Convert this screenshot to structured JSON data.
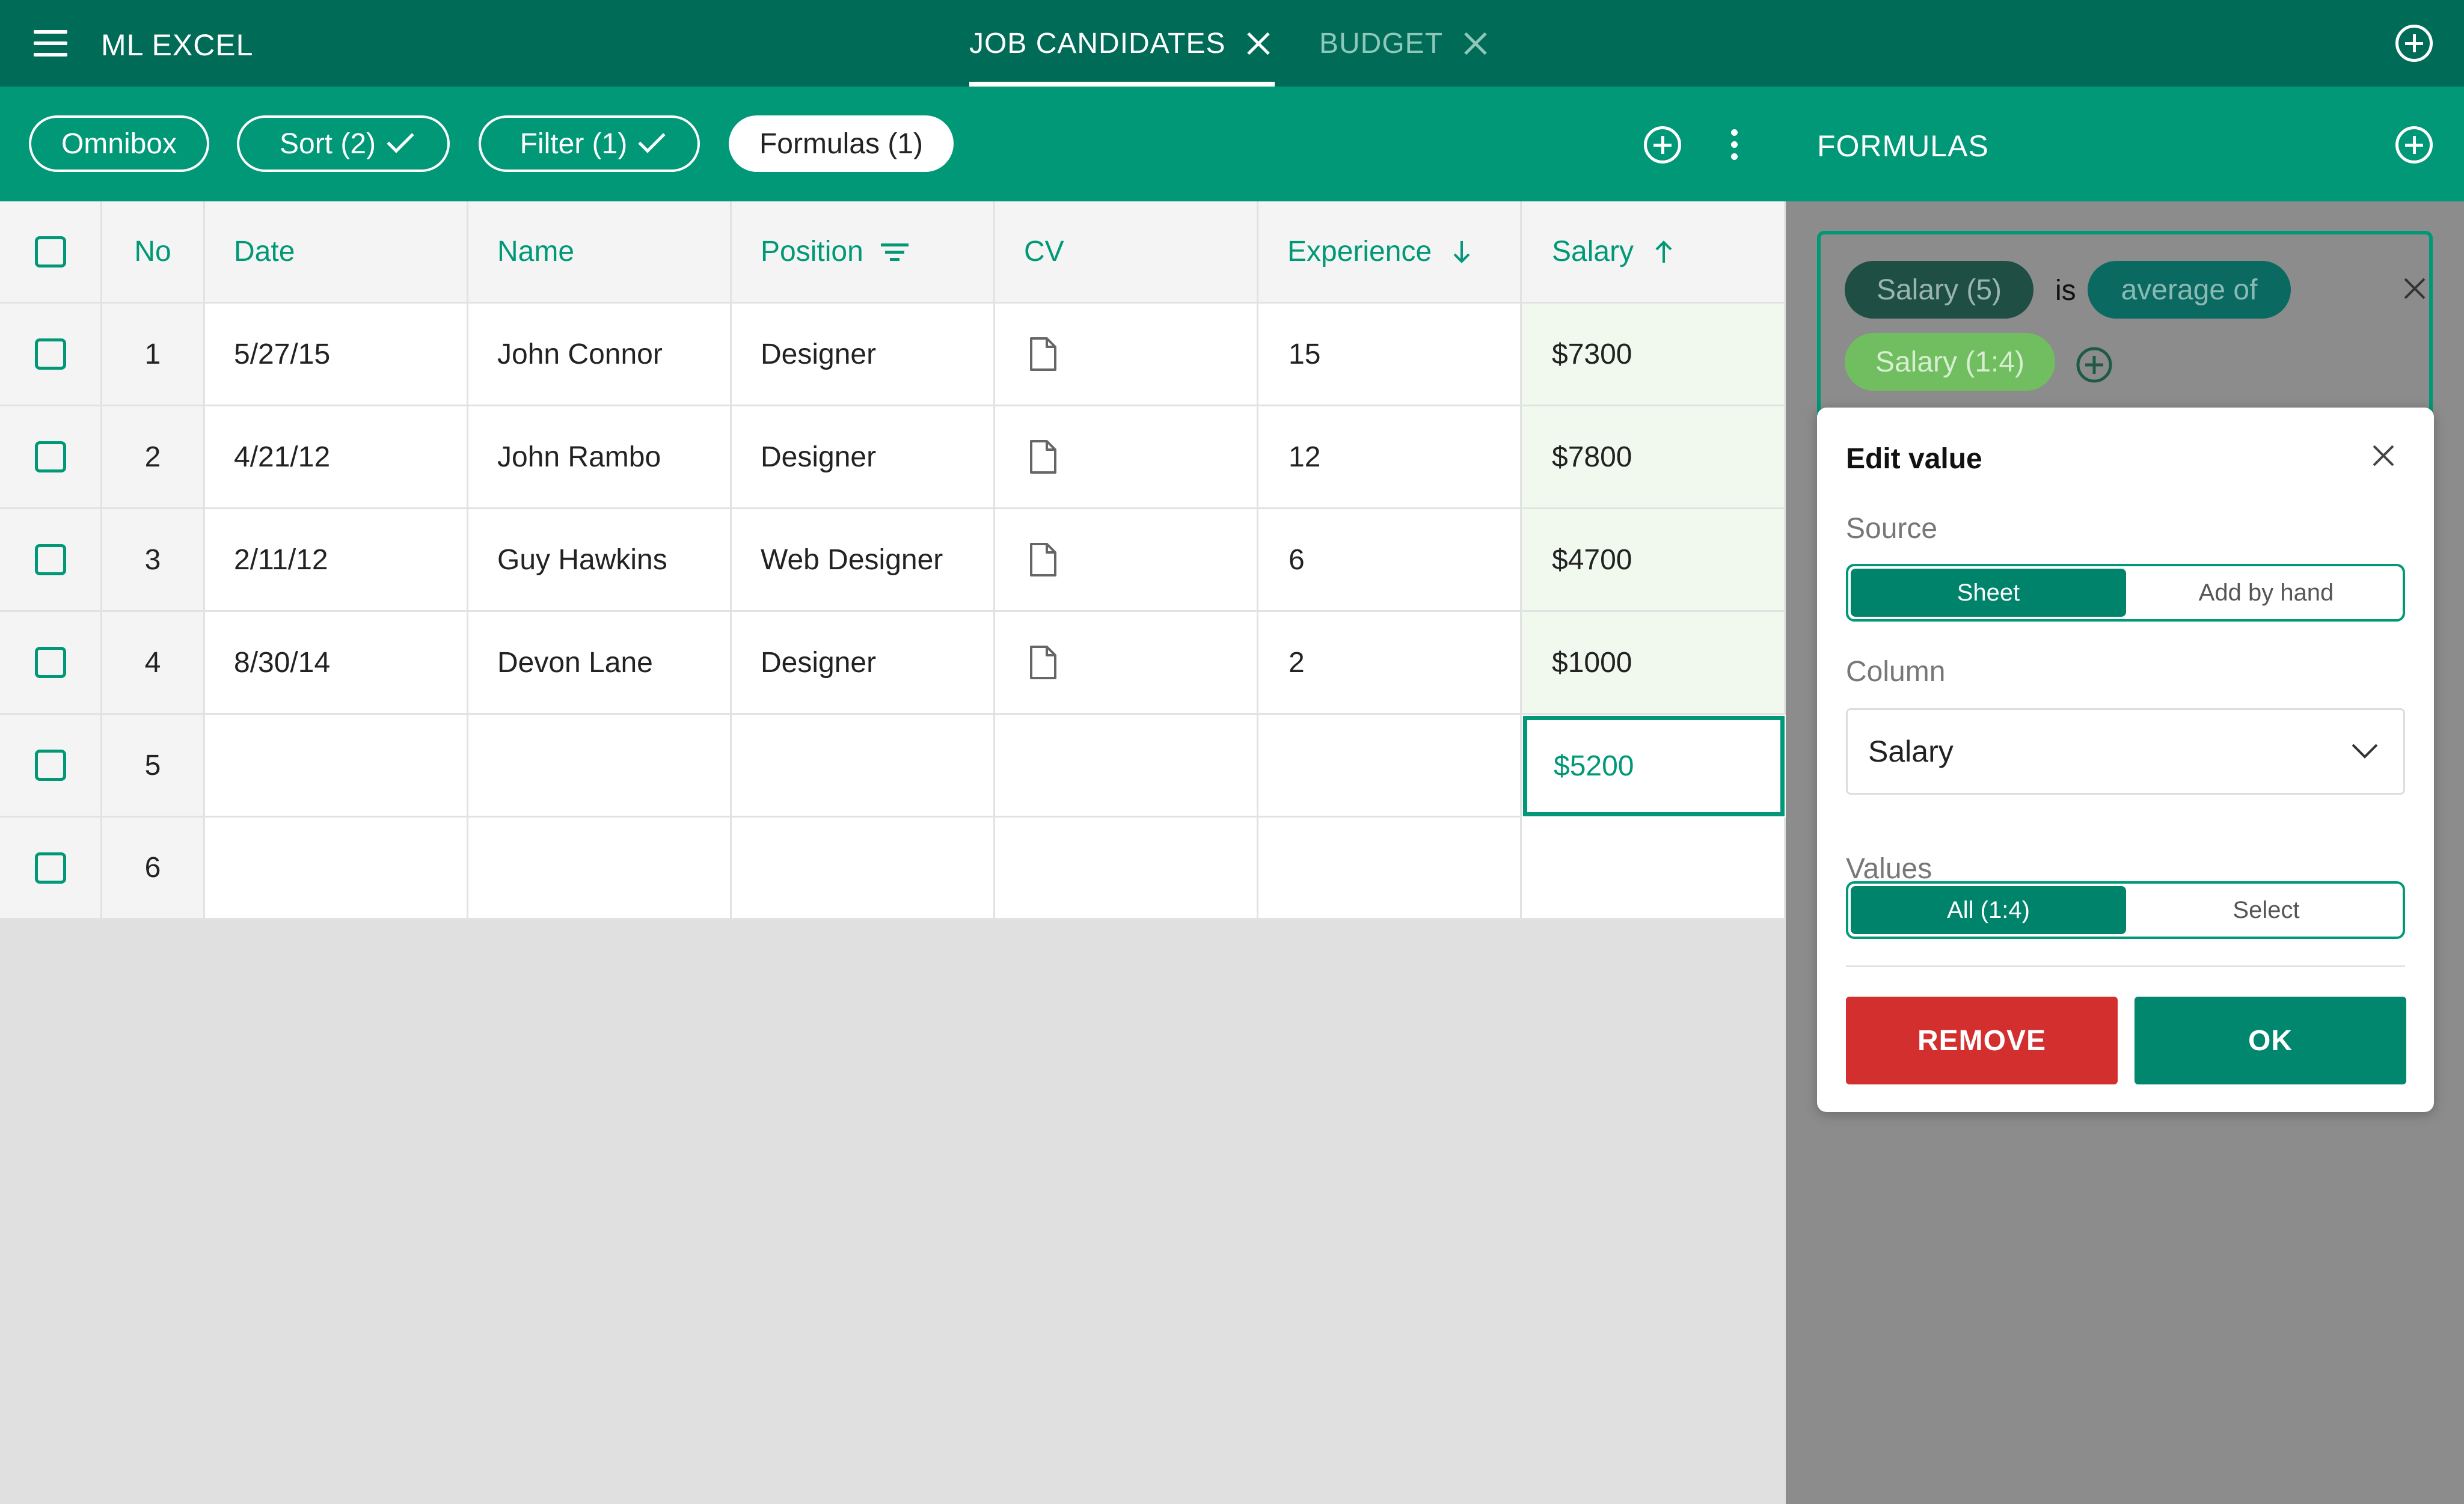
{
  "app": {
    "title": "ML EXCEL"
  },
  "tabs": [
    {
      "label": "JOB CANDIDATES",
      "active": true
    },
    {
      "label": "BUDGET",
      "active": false
    }
  ],
  "toolbar": {
    "omnibox": "Omnibox",
    "sort": "Sort (2)",
    "filter": "Filter (1)",
    "formulas": "Formulas (1)"
  },
  "table": {
    "headers": [
      "No",
      "Date",
      "Name",
      "Position",
      "CV",
      "Experience",
      "Salary"
    ],
    "rows": [
      {
        "no": "1",
        "date": "5/27/15",
        "name": "John Connor",
        "position": "Designer",
        "experience": "15",
        "salary": "$7300"
      },
      {
        "no": "2",
        "date": "4/21/12",
        "name": "John Rambo",
        "position": "Designer",
        "experience": "12",
        "salary": "$7800"
      },
      {
        "no": "3",
        "date": "2/11/12",
        "name": "Guy Hawkins",
        "position": "Web Designer",
        "experience": "6",
        "salary": "$4700"
      },
      {
        "no": "4",
        "date": "8/30/14",
        "name": "Devon Lane",
        "position": "Designer",
        "experience": "2",
        "salary": "$1000"
      },
      {
        "no": "5",
        "date": "",
        "name": "",
        "position": "",
        "experience": "",
        "salary": "$5200"
      },
      {
        "no": "6",
        "date": "",
        "name": "",
        "position": "",
        "experience": "",
        "salary": ""
      }
    ]
  },
  "panel": {
    "title": "FORMULAS",
    "formula": {
      "target": "Salary (5)",
      "verb": "is",
      "function": "average of",
      "argument": "Salary (1:4)"
    }
  },
  "edit_value": {
    "title": "Edit value",
    "source_label": "Source",
    "source_options": [
      "Sheet",
      "Add by hand"
    ],
    "column_label": "Column",
    "column_value": "Salary",
    "values_label": "Values",
    "values_options": [
      "All (1:4)",
      "Select"
    ],
    "remove_label": "REMOVE",
    "ok_label": "OK"
  },
  "colors": {
    "topbar": "#006b56",
    "accent": "#009877",
    "remove": "#d32f2f",
    "panel_bg": "#8c8c8c"
  }
}
